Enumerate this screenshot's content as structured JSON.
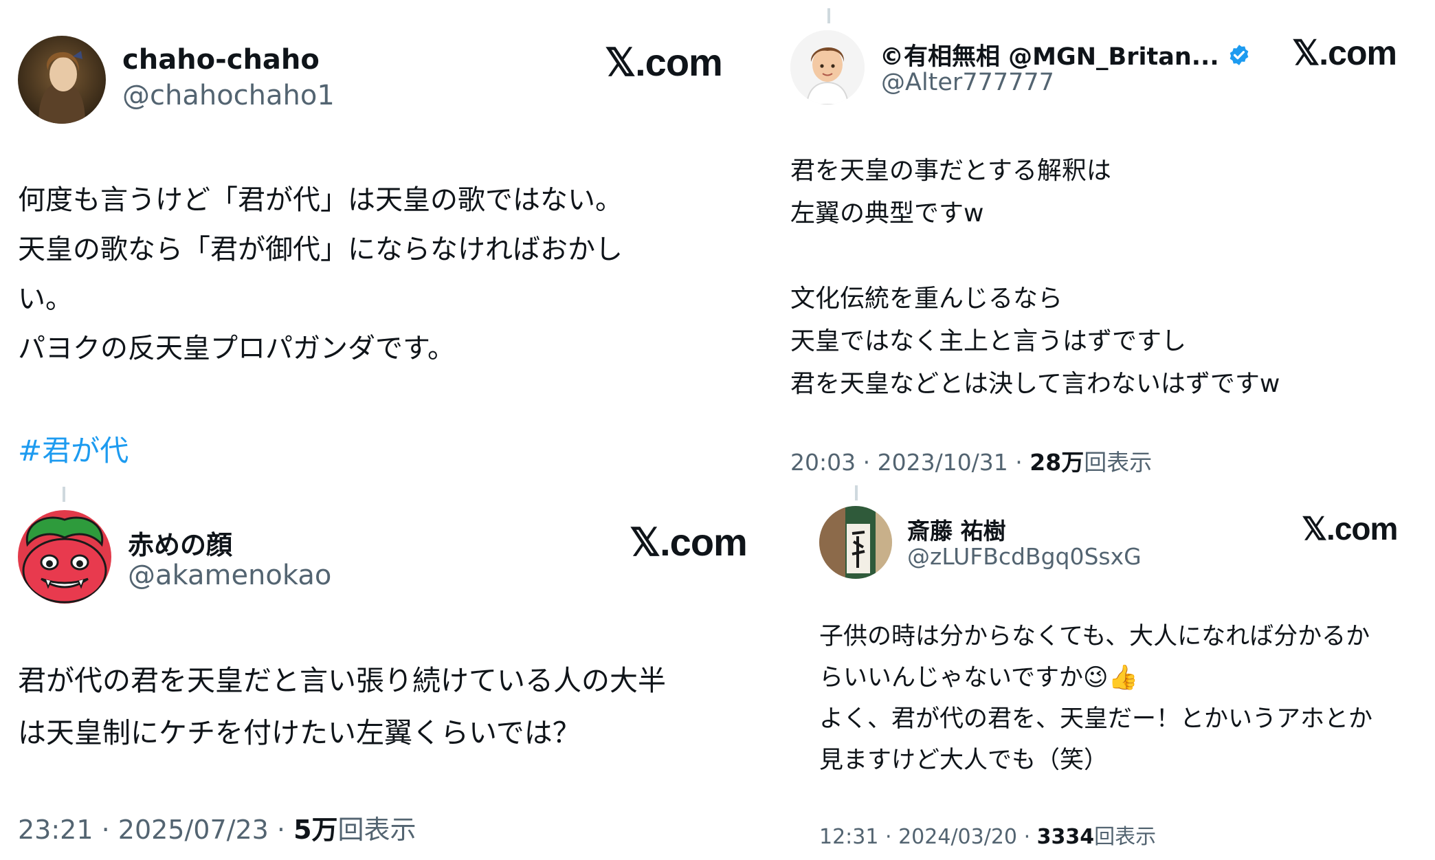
{
  "brand_label": "𝕏.com",
  "tweets": [
    {
      "name": "chaho-chaho",
      "handle": "@chahochaho1",
      "lines": [
        "何度も言うけど「君が代」は天皇の歌ではない。",
        "天皇の歌なら「君が御代」にならなければおかし",
        "い。",
        "パヨクの反天皇プロパガンダです。"
      ],
      "hashtag": "#君が代"
    },
    {
      "name": "©有相無相 @MGN_Britan...",
      "handle": "@Alter777777",
      "verified": true,
      "lines": [
        "君を天皇の事だとする解釈は",
        "左翼の典型ですw",
        "",
        "文化伝統を重んじるなら",
        "天皇ではなく主上と言うはずですし",
        "君を天皇などとは決して言わないはずですw"
      ],
      "time": "20:03",
      "date": "2023/10/31",
      "views": "28万",
      "views_label": "回表示"
    },
    {
      "name": "赤めの顔",
      "handle": "@akamenokao",
      "lines": [
        "君が代の君を天皇だと言い張り続けている人の大半",
        "は天皇制にケチを付けたい左翼くらいでは？"
      ],
      "time": "23:21",
      "date": "2025/07/23",
      "views": "5万",
      "views_label": "回表示"
    },
    {
      "name": "斎藤 祐樹",
      "handle": "@zLUFBcdBgq0SsxG",
      "lines": [
        "子供の時は分からなくても、大人になれば分かるか",
        "らいいんじゃないですか😉👍",
        "よく、君が代の君を、天皇だー！とかいうアホとか",
        "見ますけど大人でも（笑）"
      ],
      "time": "12:31",
      "date": "2024/03/20",
      "views": "3334",
      "views_label": "回表示"
    }
  ],
  "colors": {
    "text": "#0f1419",
    "secondary": "#536471",
    "hashtag": "#1d9bf0",
    "verified": "#1d9bf0"
  },
  "icons": {
    "brand": "x-logo",
    "verified": "verified-badge-icon"
  }
}
